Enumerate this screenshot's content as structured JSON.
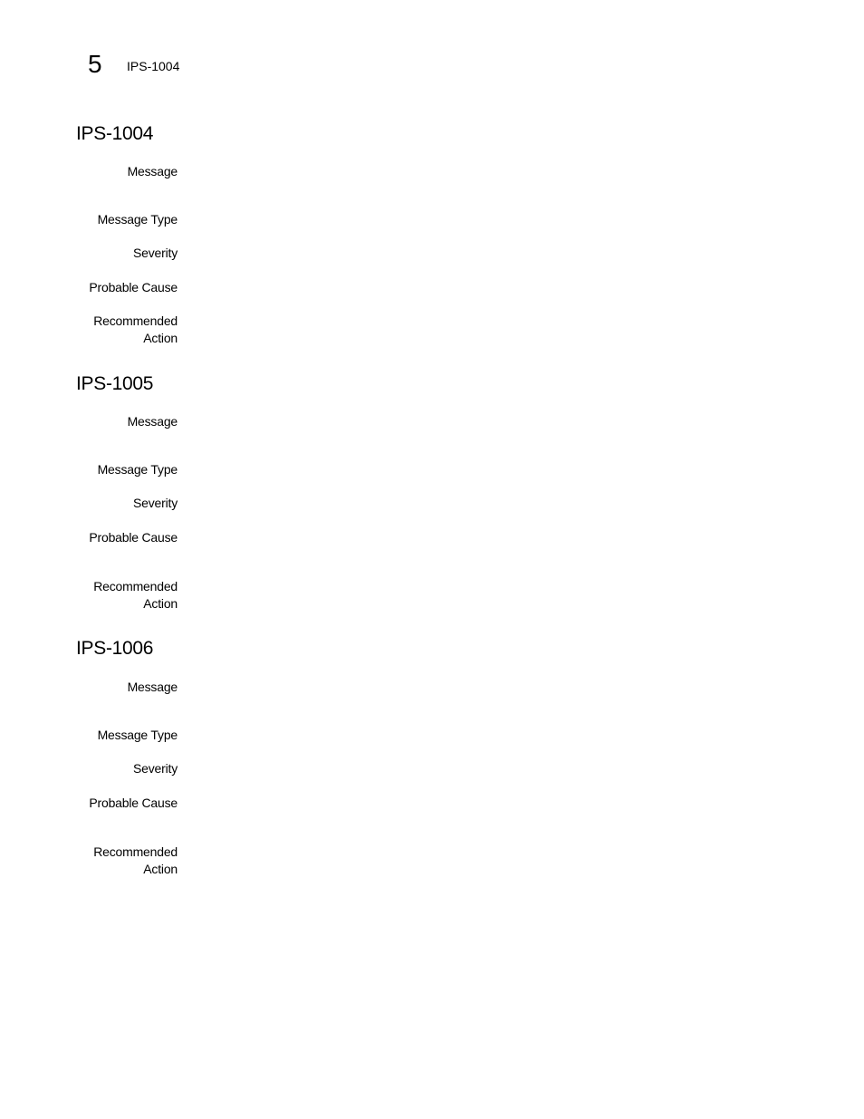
{
  "running_header": {
    "chapter_number": "5",
    "title": "IPS-1004"
  },
  "sections": [
    {
      "title": "IPS-1004",
      "labels": {
        "message": "Message",
        "message_type": "Message Type",
        "severity": "Severity",
        "probable_cause": "Probable Cause",
        "recommended_line1": "Recommended",
        "recommended_line2": "Action"
      }
    },
    {
      "title": "IPS-1005",
      "labels": {
        "message": "Message",
        "message_type": "Message Type",
        "severity": "Severity",
        "probable_cause": "Probable Cause",
        "recommended_line1": "Recommended",
        "recommended_line2": "Action"
      }
    },
    {
      "title": "IPS-1006",
      "labels": {
        "message": "Message",
        "message_type": "Message Type",
        "severity": "Severity",
        "probable_cause": "Probable Cause",
        "recommended_line1": "Recommended",
        "recommended_line2": "Action"
      }
    }
  ]
}
